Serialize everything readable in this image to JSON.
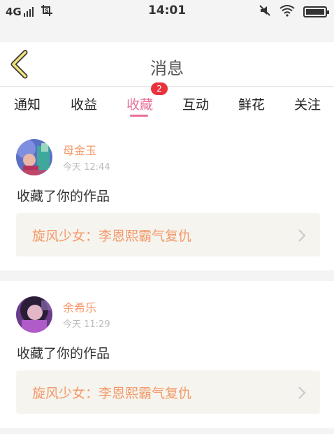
{
  "status_bar": {
    "network": "4G",
    "time": "14:01",
    "icons": [
      "signal-icon",
      "screenshot-crop-icon",
      "mute-icon",
      "wifi-icon",
      "battery-icon"
    ]
  },
  "header": {
    "title": "消息",
    "back_icon": "chevron-left-icon"
  },
  "tabs": [
    {
      "label": "通知",
      "active": false
    },
    {
      "label": "收益",
      "active": false
    },
    {
      "label": "收藏",
      "active": true,
      "badge": "2"
    },
    {
      "label": "互动",
      "active": false
    },
    {
      "label": "鲜花",
      "active": false
    },
    {
      "label": "关注",
      "active": false
    }
  ],
  "messages": [
    {
      "user": "母金玉",
      "time": "今天 12:44",
      "text": "收藏了你的作品",
      "work_title": "旋风少女：李恩熙霸气复仇"
    },
    {
      "user": "余希乐",
      "time": "今天 11:29",
      "text": "收藏了你的作品",
      "work_title": "旋风少女：李恩熙霸气复仇"
    }
  ],
  "colors": {
    "accent": "#e8709c",
    "name_orange": "#f39a6b",
    "badge_red": "#e8333e",
    "background": "#f4f4f4"
  }
}
